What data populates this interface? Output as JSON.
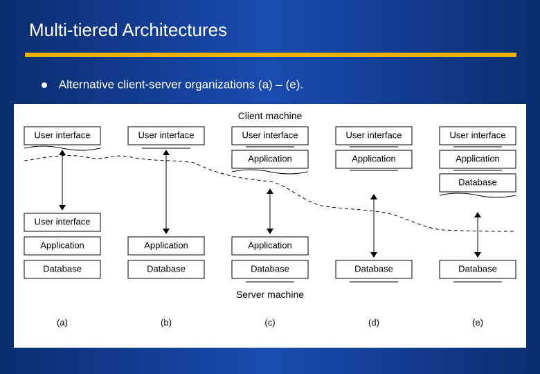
{
  "title": "Multi-tiered Architectures",
  "bullet": "Alternative client-server organizations (a) – (e).",
  "labels": {
    "client_machine": "Client machine",
    "server_machine": "Server machine",
    "user_interface": "User interface",
    "application": "Application",
    "database": "Database"
  },
  "columns": [
    "(a)",
    "(b)",
    "(c)",
    "(d)",
    "(e)"
  ],
  "configurations": [
    {
      "client": [
        "User interface"
      ],
      "server": [
        "User interface",
        "Application",
        "Database"
      ]
    },
    {
      "client": [
        "User interface"
      ],
      "server": [
        "Application",
        "Database"
      ]
    },
    {
      "client": [
        "User interface",
        "Application"
      ],
      "server": [
        "Application",
        "Database"
      ]
    },
    {
      "client": [
        "User interface",
        "Application"
      ],
      "server": [
        "Database"
      ]
    },
    {
      "client": [
        "User interface",
        "Application",
        "Database"
      ],
      "server": [
        "Database"
      ]
    }
  ]
}
